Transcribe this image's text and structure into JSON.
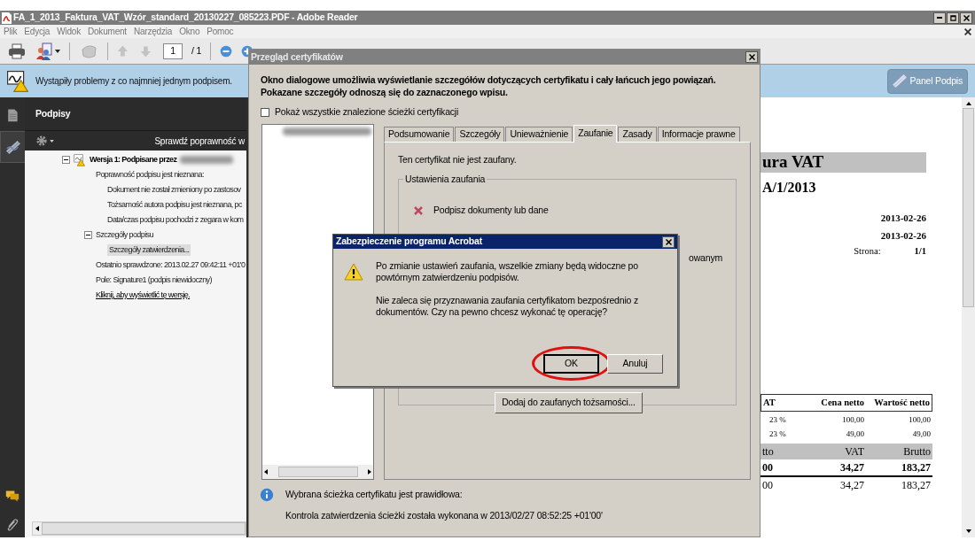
{
  "window": {
    "title": "FA_1_2013_Faktura_VAT_Wzór_standard_20130227_085223.PDF - Adobe Reader"
  },
  "menu": [
    "Plik",
    "Edycja",
    "Widok",
    "Dokument",
    "Narzędzia",
    "Okno",
    "Pomoc"
  ],
  "toolbar": {
    "page": "1",
    "page_total": "/ 1"
  },
  "notice": {
    "text": "Wystąpiły problemy z co najmniej jednym podpisem.",
    "button": "Panel Podpis"
  },
  "side_tabs": [
    {
      "kind": "pages",
      "selected": false
    },
    {
      "kind": "signatures",
      "selected": true
    }
  ],
  "signatures": {
    "title": "Podpisy",
    "action": "Sprawdź poprawność w",
    "tree": [
      {
        "label": "Wersja 1: Podpisane przez",
        "kind": "version",
        "redacted": true,
        "expanded": true,
        "selected": false,
        "children": [
          {
            "label": "Poprawność podpisu jest nieznana:",
            "kind": "text",
            "selected": false,
            "children": [
              {
                "label": "Dokument nie został zmieniony po zastosov",
                "kind": "text",
                "selected": false
              },
              {
                "label": "Tożsamość autora podpisu jest nieznana, pc",
                "kind": "text",
                "selected": false
              },
              {
                "label": "Data/czas podpisu pochodzi z zegara w kom",
                "kind": "text",
                "selected": false
              }
            ]
          },
          {
            "label": "Szczegóły podpisu",
            "kind": "group",
            "expanded": true,
            "selected": false,
            "children": [
              {
                "label": "Szczegóły zatwierdzenia...",
                "kind": "text",
                "selected": true
              }
            ]
          },
          {
            "label": "Ostatnio sprawdzone: 2013.02.27 09:42:11 +01'0",
            "kind": "text",
            "selected": false
          },
          {
            "label": "Pole: Signature1 (podpis niewidoczny)",
            "kind": "text",
            "selected": false
          },
          {
            "label": "Kliknij, aby wyświetlić tę wersję.",
            "kind": "link",
            "selected": false
          }
        ]
      }
    ]
  },
  "document": {
    "title": "ura VAT",
    "number": "A/1/2013",
    "dates": [
      "2013-02-26",
      "2013-02-26"
    ],
    "page_label": "Strona:",
    "page_value": "1/1",
    "table": {
      "columns": [
        "AT",
        "Cena netto",
        "Wartość netto"
      ],
      "rows": [
        [
          "23 %",
          "100,00",
          "100,00"
        ],
        [
          "23 %",
          "49,00",
          "49,00"
        ]
      ]
    },
    "summary": {
      "columns": [
        "tto",
        "VAT",
        "Brutto"
      ],
      "rows": [
        {
          "bold": true,
          "cells": [
            "00",
            "34,27",
            "183,27"
          ]
        },
        {
          "bold": false,
          "cells": [
            "00",
            "34,27",
            "183,27"
          ]
        }
      ]
    }
  },
  "cert_dialog": {
    "title": "Przegląd certyfikatów",
    "description": "Okno dialogowe umożliwia wyświetlanie szczegółów dotyczących certyfikatu i cały łańcuch jego powiązań. Pokazane szczegóły odnoszą się do zaznaczonego wpisu.",
    "show_all_paths": {
      "label": "Pokaż wszystkie znalezione ścieżki certyfikacji",
      "checked": false
    },
    "tabs": [
      {
        "label": "Podsumowanie",
        "selected": false
      },
      {
        "label": "Szczegóły",
        "selected": false
      },
      {
        "label": "Unieważnienie",
        "selected": false
      },
      {
        "label": "Zaufanie",
        "selected": true
      },
      {
        "label": "Zasady",
        "selected": false
      },
      {
        "label": "Informacje prawne",
        "selected": false
      }
    ],
    "trust_status": "Ten certyfikat nie jest zaufany.",
    "trust_group": "Ustawienia zaufania",
    "trust_items": [
      {
        "kind": "item",
        "allowed": false,
        "label": "Podpisz dokumenty lub dane"
      },
      {
        "kind": "fragment",
        "label": "owanym"
      }
    ],
    "add_button": "Dodaj do zaufanych tożsamości...",
    "status": "Wybrana ścieżka certyfikatu jest prawidłowa:",
    "status_detail": "Kontrola zatwierdzenia ścieżki została wykonana w 2013/02/27 08:52:25 +01'00'"
  },
  "alert": {
    "title": "Zabezpieczenie programu Acrobat",
    "paragraphs": [
      "Po zmianie ustawień zaufania, wszelkie zmiany będą widoczne po powtórnym zatwierdzeniu podpisów.",
      "Nie zaleca się przyznawania zaufania certyfikatom bezpośrednio z dokumentów. Czy na pewno chcesz wykonać tę operację?"
    ],
    "buttons": [
      {
        "label": "OK",
        "default": true,
        "circled": true
      },
      {
        "label": "Anuluj",
        "default": false,
        "circled": false
      }
    ]
  }
}
